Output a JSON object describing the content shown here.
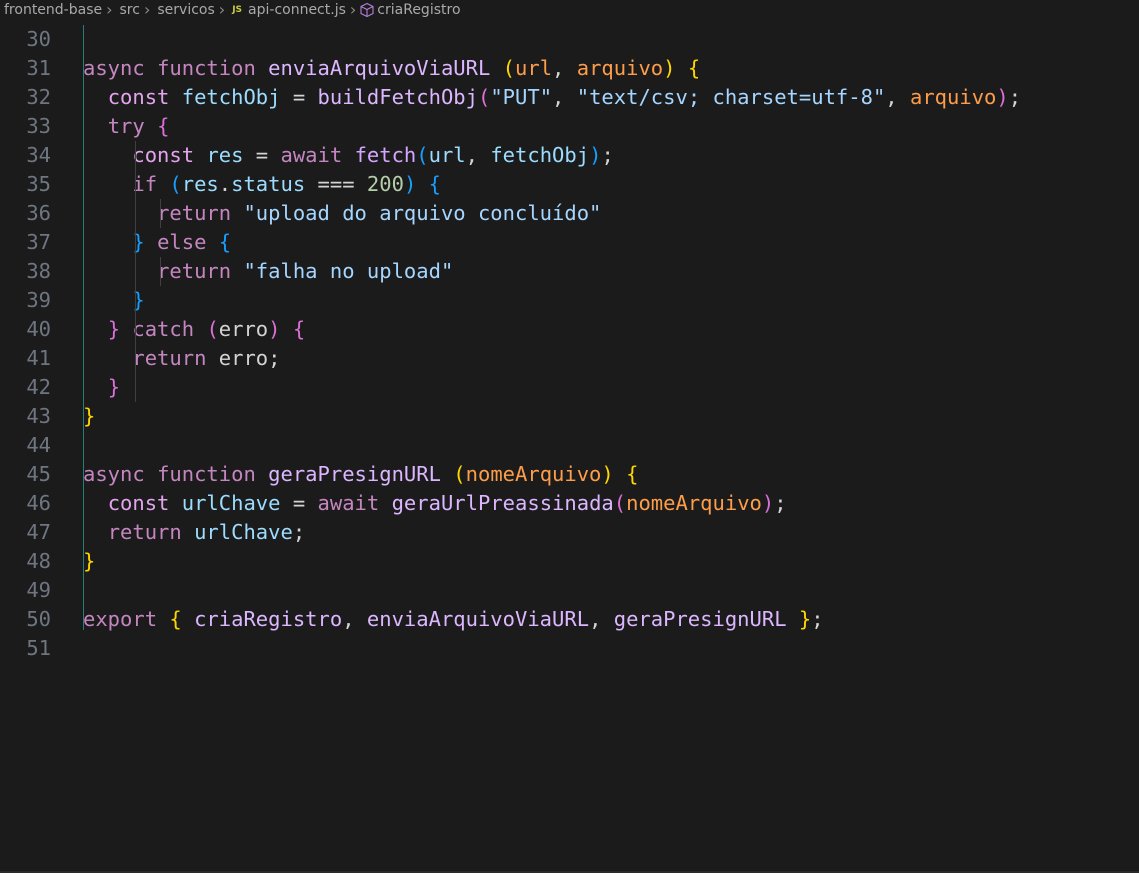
{
  "breadcrumb": {
    "items": [
      {
        "label": "frontend-base"
      },
      {
        "label": "src"
      },
      {
        "label": "servicos"
      },
      {
        "label": "api-connect.js",
        "icon": "js-file-icon",
        "icon_text": "JS"
      },
      {
        "label": "criaRegistro",
        "icon": "symbol-icon"
      }
    ]
  },
  "editor": {
    "language": "javascript",
    "first_line": 30,
    "lines": [
      {
        "n": "30",
        "tokens": []
      },
      {
        "n": "31",
        "tokens": [
          [
            "kw",
            "async"
          ],
          [
            "pl",
            " "
          ],
          [
            "kw",
            "function"
          ],
          [
            "pl",
            " "
          ],
          [
            "fn",
            "enviaArquivoViaURL"
          ],
          [
            "pl",
            " "
          ],
          [
            "bk1",
            "("
          ],
          [
            "pa",
            "url"
          ],
          [
            "pl",
            ", "
          ],
          [
            "pa",
            "arquivo"
          ],
          [
            "bk1",
            ")"
          ],
          [
            "pl",
            " "
          ],
          [
            "bk1",
            "{"
          ]
        ]
      },
      {
        "n": "32",
        "tokens": [
          [
            "pl",
            "  "
          ],
          [
            "st",
            "const"
          ],
          [
            "pl",
            " "
          ],
          [
            "va",
            "fetchObj"
          ],
          [
            "pl",
            " = "
          ],
          [
            "fn",
            "buildFetchObj"
          ],
          [
            "bk2",
            "("
          ],
          [
            "str",
            "\"PUT\""
          ],
          [
            "pl",
            ", "
          ],
          [
            "str",
            "\"text/csv; charset=utf-8\""
          ],
          [
            "pl",
            ", "
          ],
          [
            "pa",
            "arquivo"
          ],
          [
            "bk2",
            ")"
          ],
          [
            "pl",
            ";"
          ]
        ]
      },
      {
        "n": "33",
        "tokens": [
          [
            "pl",
            "  "
          ],
          [
            "kw",
            "try"
          ],
          [
            "pl",
            " "
          ],
          [
            "bk2",
            "{"
          ]
        ]
      },
      {
        "n": "34",
        "tokens": [
          [
            "pl",
            "    "
          ],
          [
            "st",
            "const"
          ],
          [
            "pl",
            " "
          ],
          [
            "va",
            "res"
          ],
          [
            "pl",
            " = "
          ],
          [
            "kw",
            "await"
          ],
          [
            "pl",
            " "
          ],
          [
            "fn2",
            "fetch"
          ],
          [
            "bk3",
            "("
          ],
          [
            "va",
            "url"
          ],
          [
            "pl",
            ", "
          ],
          [
            "va",
            "fetchObj"
          ],
          [
            "bk3",
            ")"
          ],
          [
            "pl",
            ";"
          ]
        ]
      },
      {
        "n": "35",
        "tokens": [
          [
            "pl",
            "    "
          ],
          [
            "kw",
            "if"
          ],
          [
            "pl",
            " "
          ],
          [
            "bk3",
            "("
          ],
          [
            "va",
            "res"
          ],
          [
            "pl",
            "."
          ],
          [
            "va",
            "status"
          ],
          [
            "pl",
            " === "
          ],
          [
            "num",
            "200"
          ],
          [
            "bk3",
            ")"
          ],
          [
            "pl",
            " "
          ],
          [
            "bk3",
            "{"
          ]
        ]
      },
      {
        "n": "36",
        "tokens": [
          [
            "pl",
            "      "
          ],
          [
            "kw",
            "return"
          ],
          [
            "pl",
            " "
          ],
          [
            "str",
            "\"upload do arquivo concluído\""
          ]
        ]
      },
      {
        "n": "37",
        "tokens": [
          [
            "pl",
            "    "
          ],
          [
            "bk3",
            "}"
          ],
          [
            "pl",
            " "
          ],
          [
            "kw",
            "else"
          ],
          [
            "pl",
            " "
          ],
          [
            "bk3",
            "{"
          ]
        ]
      },
      {
        "n": "38",
        "tokens": [
          [
            "pl",
            "      "
          ],
          [
            "kw",
            "return"
          ],
          [
            "pl",
            " "
          ],
          [
            "str",
            "\"falha no upload\""
          ]
        ]
      },
      {
        "n": "39",
        "tokens": [
          [
            "pl",
            "    "
          ],
          [
            "bk3",
            "}"
          ]
        ]
      },
      {
        "n": "40",
        "tokens": [
          [
            "pl",
            "  "
          ],
          [
            "bk2",
            "}"
          ],
          [
            "pl",
            " "
          ],
          [
            "kw",
            "catch"
          ],
          [
            "pl",
            " "
          ],
          [
            "bk2",
            "("
          ],
          [
            "pl",
            "erro"
          ],
          [
            "bk2",
            ")"
          ],
          [
            "pl",
            " "
          ],
          [
            "bk2",
            "{"
          ]
        ]
      },
      {
        "n": "41",
        "tokens": [
          [
            "pl",
            "    "
          ],
          [
            "kw",
            "return"
          ],
          [
            "pl",
            " erro;"
          ]
        ]
      },
      {
        "n": "42",
        "tokens": [
          [
            "pl",
            "  "
          ],
          [
            "bk2",
            "}"
          ]
        ]
      },
      {
        "n": "43",
        "tokens": [
          [
            "bk1",
            "}"
          ]
        ]
      },
      {
        "n": "44",
        "tokens": []
      },
      {
        "n": "45",
        "tokens": [
          [
            "kw",
            "async"
          ],
          [
            "pl",
            " "
          ],
          [
            "kw",
            "function"
          ],
          [
            "pl",
            " "
          ],
          [
            "fn",
            "geraPresignURL"
          ],
          [
            "pl",
            " "
          ],
          [
            "bk1",
            "("
          ],
          [
            "pa",
            "nomeArquivo"
          ],
          [
            "bk1",
            ")"
          ],
          [
            "pl",
            " "
          ],
          [
            "bk1",
            "{"
          ]
        ]
      },
      {
        "n": "46",
        "tokens": [
          [
            "pl",
            "  "
          ],
          [
            "st",
            "const"
          ],
          [
            "pl",
            " "
          ],
          [
            "va",
            "urlChave"
          ],
          [
            "pl",
            " = "
          ],
          [
            "kw",
            "await"
          ],
          [
            "pl",
            " "
          ],
          [
            "fn",
            "geraUrlPreassinada"
          ],
          [
            "bk2",
            "("
          ],
          [
            "pa",
            "nomeArquivo"
          ],
          [
            "bk2",
            ")"
          ],
          [
            "pl",
            ";"
          ]
        ]
      },
      {
        "n": "47",
        "tokens": [
          [
            "pl",
            "  "
          ],
          [
            "kw",
            "return"
          ],
          [
            "pl",
            " "
          ],
          [
            "va",
            "urlChave"
          ],
          [
            "pl",
            ";"
          ]
        ]
      },
      {
        "n": "48",
        "tokens": [
          [
            "bk1",
            "}"
          ]
        ]
      },
      {
        "n": "49",
        "tokens": []
      },
      {
        "n": "50",
        "tokens": [
          [
            "kw",
            "export"
          ],
          [
            "pl",
            " "
          ],
          [
            "bk1",
            "{"
          ],
          [
            "pl",
            " "
          ],
          [
            "fn",
            "criaRegistro"
          ],
          [
            "pl",
            ", "
          ],
          [
            "fn",
            "enviaArquivoViaURL"
          ],
          [
            "pl",
            ", "
          ],
          [
            "fn",
            "geraPresignURL"
          ],
          [
            "pl",
            " "
          ],
          [
            "bk1",
            "}"
          ],
          [
            "pl",
            ";"
          ]
        ]
      },
      {
        "n": "51",
        "tokens": []
      }
    ]
  },
  "colors": {
    "background": "#1b1b1c",
    "line_number": "#6e7681",
    "keyword": "#c586c0",
    "function": "#dcb6ff",
    "parameter": "#fd9d49",
    "variable": "#9cdcfe",
    "string": "#a5d6ff",
    "number": "#b5cea8",
    "bracket_level1": "#ffd700",
    "bracket_level2": "#da70d6",
    "bracket_level3": "#179fff",
    "active_indent_guide": "#2aa198"
  }
}
